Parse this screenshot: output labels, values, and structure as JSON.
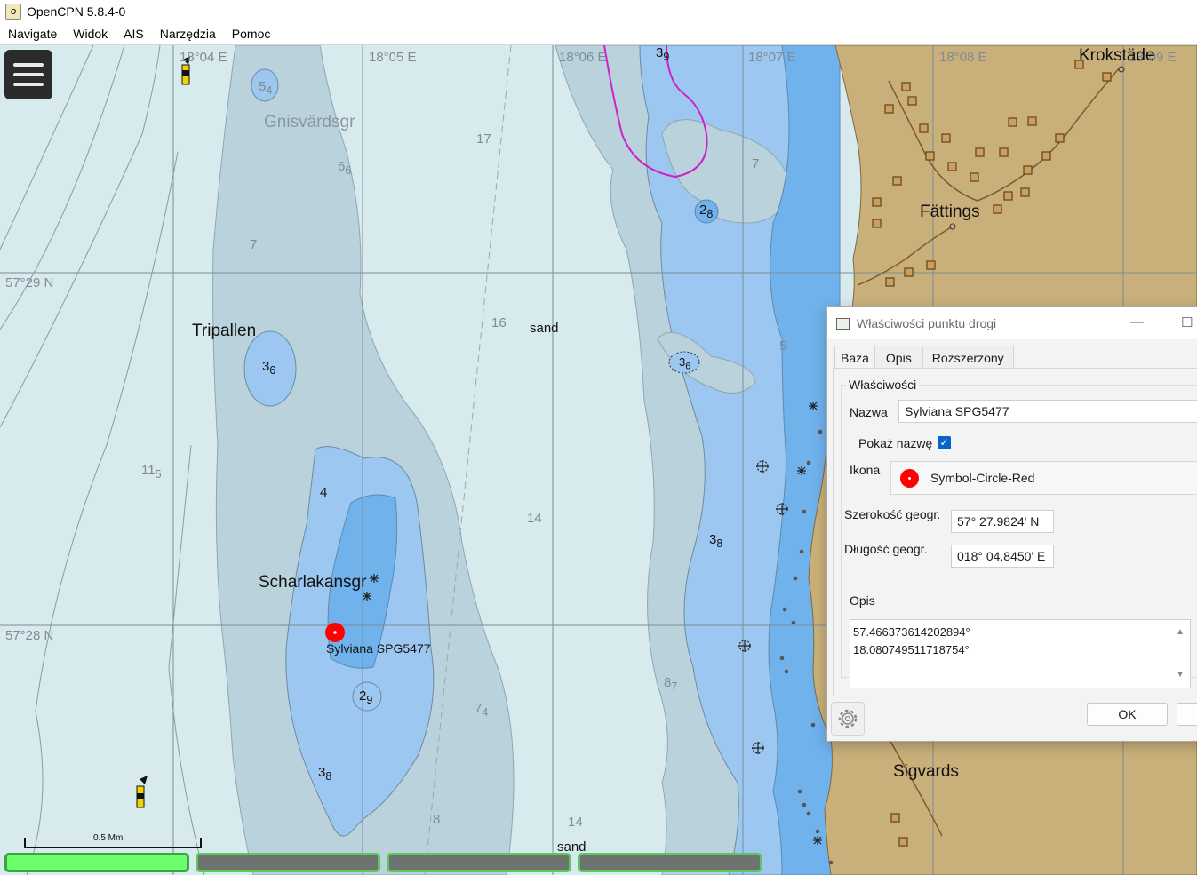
{
  "window": {
    "title": "OpenCPN 5.8.4-0"
  },
  "menu": [
    "Navigate",
    "Widok",
    "AIS",
    "Narzędzia",
    "Pomoc"
  ],
  "chart": {
    "longitude_labels": [
      "18°04 E",
      "18°05 E",
      "18°06 E",
      "18°07 E",
      "18°08 E",
      "18°09 E"
    ],
    "latitude_labels": [
      "57°29 N",
      "57°28 N"
    ],
    "place_names": [
      "Gnisvärdsgr",
      "Tripallen",
      "Scharlakansgr",
      "Fättings",
      "Krokstäde",
      "Sigvards"
    ],
    "seabed_labels": [
      "sand",
      "sand"
    ],
    "soundings": [
      "17",
      "7",
      "16",
      "14",
      "8",
      "14",
      "5",
      "4",
      "7"
    ],
    "soundings_sub": [
      {
        "main": "5",
        "sub": "4"
      },
      {
        "main": "6",
        "sub": "6"
      },
      {
        "main": "3",
        "sub": "6"
      },
      {
        "main": "11",
        "sub": "5"
      },
      {
        "main": "2",
        "sub": "9"
      },
      {
        "main": "3",
        "sub": "8"
      },
      {
        "main": "7",
        "sub": "4"
      },
      {
        "main": "3",
        "sub": "9"
      },
      {
        "main": "2",
        "sub": "8"
      },
      {
        "main": "3",
        "sub": "6"
      },
      {
        "main": "3",
        "sub": "8"
      },
      {
        "main": "8",
        "sub": "7"
      }
    ],
    "waypoint_label": "Sylviana SPG5477",
    "scale_label": "0.5 Mm"
  },
  "dialog": {
    "title": "Właściwości punktu drogi",
    "tabs": [
      "Baza",
      "Opis",
      "Rozszerzony"
    ],
    "group_label": "Właściwości",
    "name_label": "Nazwa",
    "name_value": "Sylviana SPG5477",
    "show_name_label": "Pokaż nazwę",
    "show_name_checked": true,
    "icon_label": "Ikona",
    "icon_value": "Symbol-Circle-Red",
    "lat_label": "Szerokość geogr.",
    "lat_value": "57° 27.9824' N",
    "lon_label": "Długość geogr.",
    "lon_value": "018° 04.8450' E",
    "desc_label": "Opis",
    "desc_line1": "57.466373614202894°",
    "desc_line2": "18.080749511718754°",
    "ok_label": "OK"
  },
  "colors": {
    "deep_water": "#d7eaee",
    "mid_water": "#b9d2dc",
    "shallow_water": "#9cc7f0",
    "very_shallow": "#6fb2ec",
    "land": "#c9b07a",
    "status_active": "#6cff6c"
  }
}
